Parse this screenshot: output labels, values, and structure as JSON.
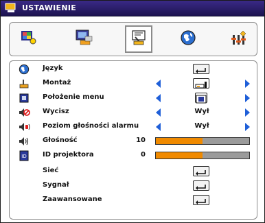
{
  "title": "USTAWIENIE",
  "tabs": [
    {
      "id": "image",
      "icon": "picture-settings-icon",
      "selected": false
    },
    {
      "id": "display",
      "icon": "display-icon",
      "selected": false
    },
    {
      "id": "setup",
      "icon": "setup-icon",
      "selected": true
    },
    {
      "id": "network",
      "icon": "globe-icon",
      "selected": false
    },
    {
      "id": "options",
      "icon": "options-icon",
      "selected": false
    }
  ],
  "menu": [
    {
      "label": "Język",
      "icon": "globe-icon",
      "control": "enter"
    },
    {
      "label": "Montaż",
      "icon": "projector-icon",
      "control": "select-icon"
    },
    {
      "label": "Położenie menu",
      "icon": "menu-location-icon",
      "control": "select-icon"
    },
    {
      "label": "Wycisz",
      "icon": "mute-icon",
      "control": "select",
      "value": "Wył"
    },
    {
      "label": "Poziom głośności alarmu",
      "icon": "alarm-volume-icon",
      "control": "select",
      "value": "Wył"
    },
    {
      "label": "Głośność",
      "icon": "volume-icon",
      "control": "slider",
      "value": "10",
      "level": 0.5
    },
    {
      "label": "ID projektora",
      "icon": "projector-id-icon",
      "control": "slider",
      "value": "0",
      "level": 0.5
    },
    {
      "label": "Sieć",
      "icon": "",
      "control": "enter"
    },
    {
      "label": "Sygnał",
      "icon": "",
      "control": "enter"
    },
    {
      "label": "Zaawansowane",
      "icon": "",
      "control": "enter"
    }
  ],
  "colors": {
    "titlebar": "#2a1e6a",
    "accent": "#1f5fd8",
    "bar_fill": "#f08a00",
    "bar_empty": "#9b9b9b"
  }
}
